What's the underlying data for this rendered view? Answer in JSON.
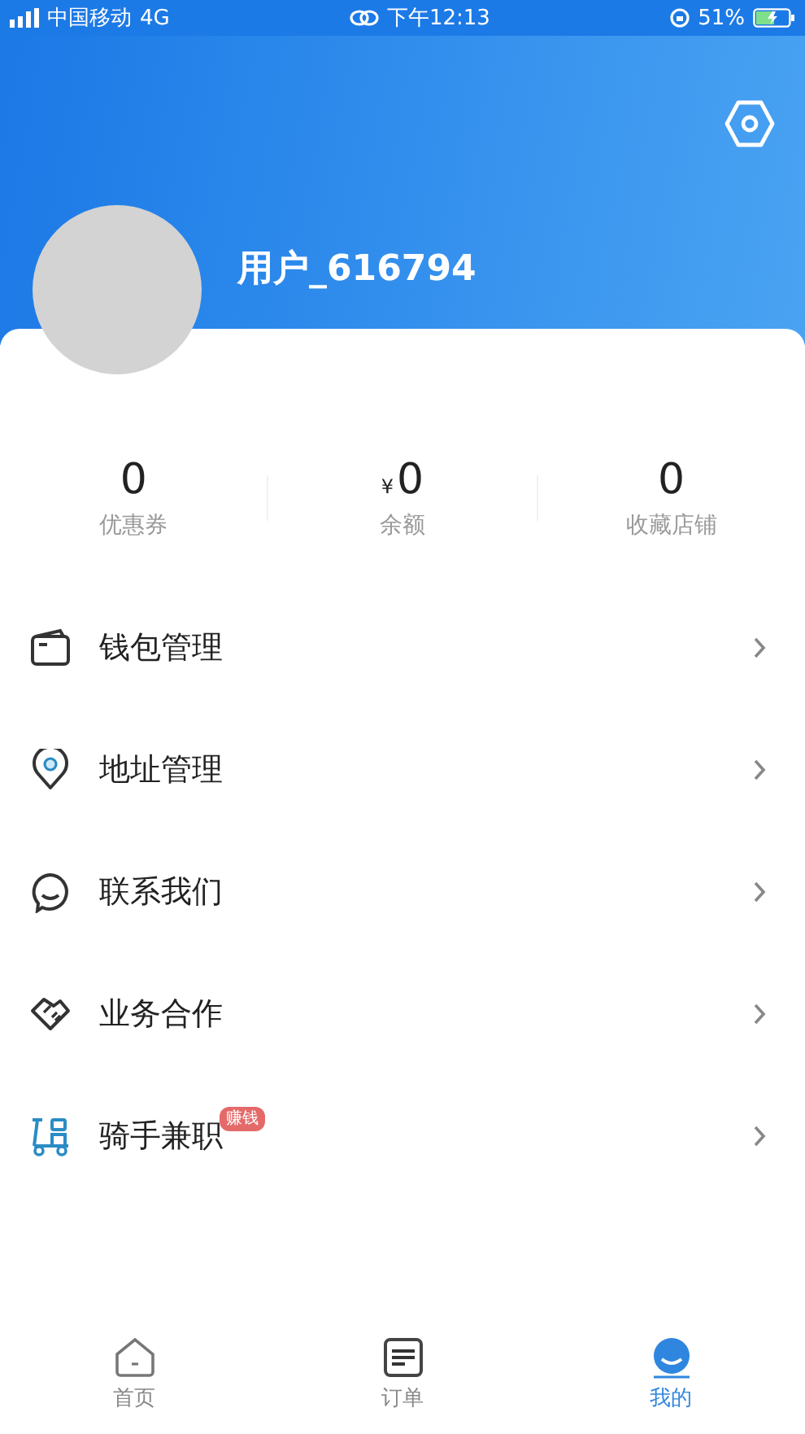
{
  "status_bar": {
    "carrier": "中国移动",
    "network": "4G",
    "time": "下午12:13",
    "battery": "51%"
  },
  "profile": {
    "username": "用户_616794"
  },
  "stats": [
    {
      "kind": "plain",
      "value": "0",
      "label": "优惠券"
    },
    {
      "kind": "money",
      "currency": "¥",
      "value": "0",
      "label": "余额"
    },
    {
      "kind": "plain",
      "value": "0",
      "label": "收藏店铺"
    }
  ],
  "menu": [
    {
      "kind": "wallet",
      "label": "钱包管理"
    },
    {
      "kind": "pin",
      "label": "地址管理"
    },
    {
      "kind": "chat",
      "label": "联系我们"
    },
    {
      "kind": "handshake",
      "label": "业务合作"
    },
    {
      "kind": "scooter",
      "label": "骑手兼职",
      "badge": "赚钱"
    }
  ],
  "tabs": [
    {
      "kind": "home",
      "label": "首页",
      "selected": false
    },
    {
      "kind": "orders",
      "label": "订单",
      "selected": false
    },
    {
      "kind": "me",
      "label": "我的",
      "selected": true
    }
  ]
}
